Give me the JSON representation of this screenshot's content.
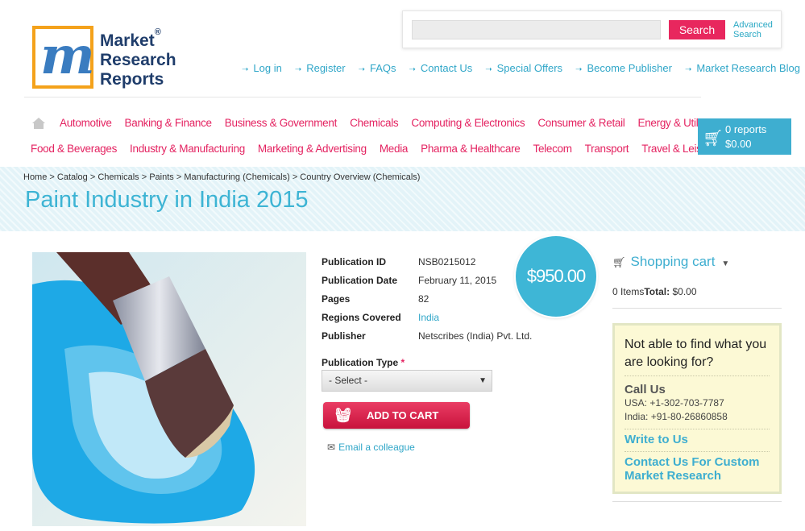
{
  "logo": {
    "line1": "Market",
    "line2": "Research",
    "line3": "Reports",
    "reg": "®"
  },
  "search": {
    "placeholder": "",
    "button": "Search",
    "advanced_line1": "Advanced",
    "advanced_line2": "Search"
  },
  "topnav": [
    "Log in",
    "Register",
    "FAQs",
    "Contact Us",
    "Special Offers",
    "Become Publisher",
    "Market Research Blog"
  ],
  "categories_row1": [
    "Automotive",
    "Banking & Finance",
    "Business & Government",
    "Chemicals",
    "Computing & Electronics",
    "Consumer & Retail",
    "Energy & Utilities"
  ],
  "categories_row2": [
    "Food & Beverages",
    "Industry & Manufacturing",
    "Marketing & Advertising",
    "Media",
    "Pharma & Healthcare",
    "Telecom",
    "Transport",
    "Travel & Leisure"
  ],
  "cart": {
    "reports": "0 reports",
    "total": "$0.00"
  },
  "breadcrumb": "Home > Catalog > Chemicals > Paints > Manufacturing (Chemicals) > Country Overview (Chemicals)",
  "title": "Paint Industry in India 2015",
  "price": "$950.00",
  "details": [
    {
      "k": "Publication ID",
      "v": "NSB0215012"
    },
    {
      "k": "Publication Date",
      "v": "February 11, 2015"
    },
    {
      "k": "Pages",
      "v": "82"
    },
    {
      "k": "Regions Covered",
      "v": "India"
    },
    {
      "k": "Publisher",
      "v": "Netscribes (India) Pvt. Ltd."
    }
  ],
  "publication_type": {
    "label": "Publication Type",
    "required": "*",
    "selected": "- Select -"
  },
  "add_to_cart": "ADD TO CART",
  "email_colleague": "Email a colleague",
  "shopping_cart": {
    "title": "Shopping cart",
    "items": "0 Items",
    "total_label": "Total:",
    "total": "$0.00"
  },
  "help": {
    "heading": "Not able to find what you are looking for?",
    "call": "Call Us",
    "usa": "USA: +1-302-703-7787",
    "india": "India: +91-80-26860858",
    "write": "Write to Us",
    "custom": "Contact Us For Custom Market Research"
  },
  "colors": {
    "accent": "#3eaed0",
    "brand_pink": "#e42361"
  }
}
